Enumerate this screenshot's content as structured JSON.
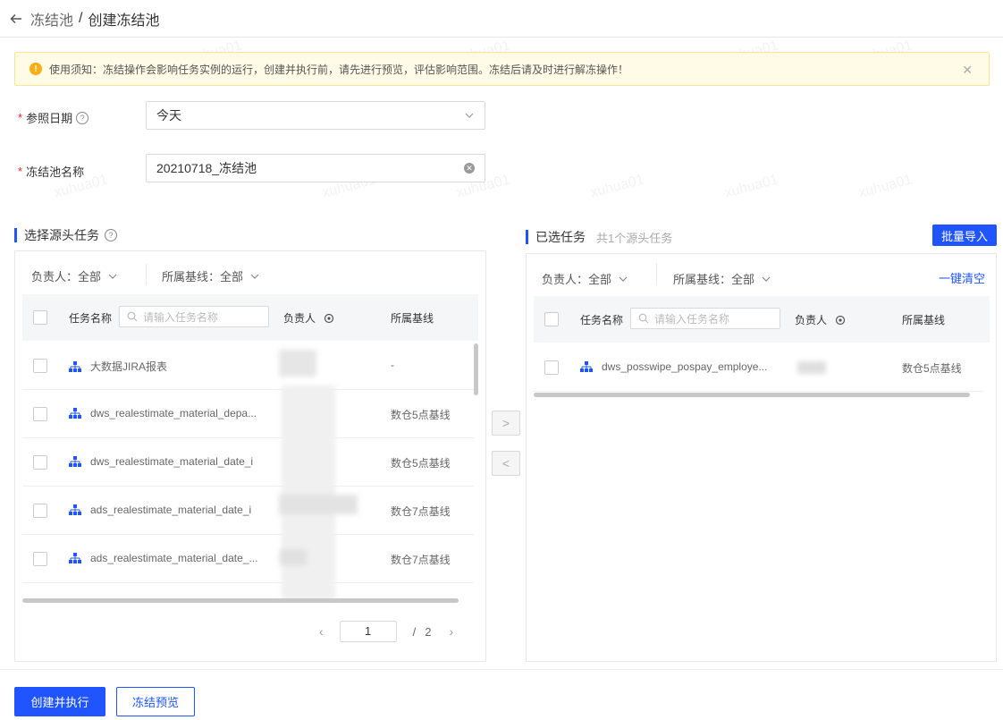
{
  "header": {
    "parent": "冻结池",
    "separator": "/",
    "current": "创建冻结池"
  },
  "notice": {
    "text": "使用须知：冻结操作会影响任务实例的运行，创建并执行前，请先进行预览，评估影响范围。冻结后请及时进行解冻操作！"
  },
  "form": {
    "date_label": "参照日期",
    "date_value": "今天",
    "name_label": "冻结池名称",
    "name_value": "20210718_冻结池"
  },
  "left": {
    "title": "选择源头任务",
    "filter_owner": "负责人：全部",
    "filter_baseline": "所属基线：全部",
    "col_name": "任务名称",
    "search_placeholder": "请输入任务名称",
    "col_owner": "负责人",
    "col_baseline": "所属基线",
    "rows": [
      {
        "name": "大数据JIRA报表",
        "baseline": "-"
      },
      {
        "name": "dws_realestimate_material_depa...",
        "baseline": "数仓5点基线"
      },
      {
        "name": "dws_realestimate_material_date_i",
        "baseline": "数仓5点基线"
      },
      {
        "name": "ads_realestimate_material_date_i",
        "baseline": "数仓7点基线"
      },
      {
        "name": "ads_realestimate_material_date_...",
        "baseline": "数仓7点基线"
      }
    ],
    "page_current": "1",
    "page_sep": "/",
    "page_total": "2"
  },
  "right": {
    "title": "已选任务",
    "subtitle": "共1个源头任务",
    "batch_import": "批量导入",
    "filter_owner": "负责人：全部",
    "filter_baseline": "所属基线：全部",
    "clear_all": "一键清空",
    "col_name": "任务名称",
    "search_placeholder": "请输入任务名称",
    "col_owner": "负责人",
    "col_baseline": "所属基线",
    "rows": [
      {
        "name": "dws_posswipe_pospay_employe...",
        "baseline": "数仓5点基线"
      }
    ]
  },
  "transfer": {
    "right": ">",
    "left": "<"
  },
  "actions": {
    "create_execute": "创建并执行",
    "preview": "冻结预览"
  },
  "watermark": "xuhua01",
  "colors": {
    "primary": "#1f54ff",
    "warning": "#faad14",
    "required": "#f5222d"
  }
}
